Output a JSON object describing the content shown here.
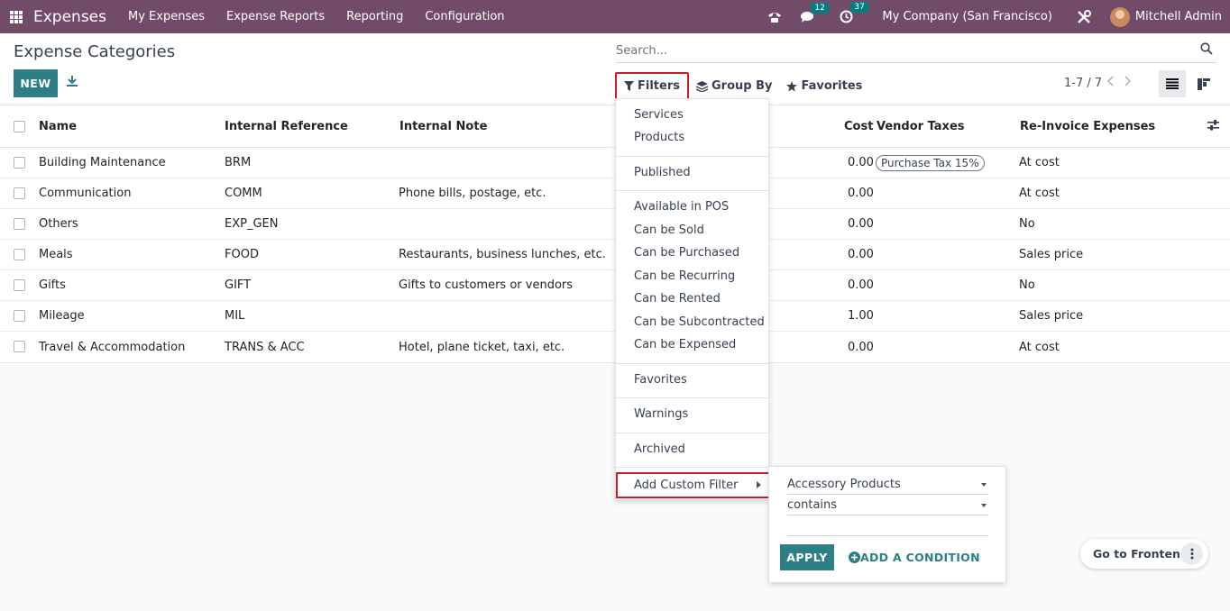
{
  "navbar": {
    "brand": "Expenses",
    "menu": [
      "My Expenses",
      "Expense Reports",
      "Reporting",
      "Configuration"
    ],
    "messages_count": "12",
    "activities_count": "37",
    "company": "My Company (San Francisco)",
    "user": "Mitchell Admin"
  },
  "control": {
    "title": "Expense Categories",
    "new_label": "NEW",
    "search_placeholder": "Search...",
    "filters_label": "Filters",
    "groupby_label": "Group By",
    "favorites_label": "Favorites",
    "pager": "1-7 / 7"
  },
  "table": {
    "columns": [
      "Name",
      "Internal Reference",
      "Internal Note",
      "Cost",
      "Vendor Taxes",
      "Re-Invoice Expenses"
    ],
    "rows": [
      {
        "name": "Building Maintenance",
        "ref": "BRM",
        "note": "",
        "cost": "0.00",
        "tax": "Purchase Tax 15%",
        "reinvoice": "At cost"
      },
      {
        "name": "Communication",
        "ref": "COMM",
        "note": "Phone bills, postage, etc.",
        "cost": "0.00",
        "tax": "",
        "reinvoice": "At cost"
      },
      {
        "name": "Others",
        "ref": "EXP_GEN",
        "note": "",
        "cost": "0.00",
        "tax": "",
        "reinvoice": "No"
      },
      {
        "name": "Meals",
        "ref": "FOOD",
        "note": "Restaurants, business lunches, etc.",
        "cost": "0.00",
        "tax": "",
        "reinvoice": "Sales price"
      },
      {
        "name": "Gifts",
        "ref": "GIFT",
        "note": "Gifts to customers or vendors",
        "cost": "0.00",
        "tax": "",
        "reinvoice": "No"
      },
      {
        "name": "Mileage",
        "ref": "MIL",
        "note": "",
        "cost": "1.00",
        "tax": "",
        "reinvoice": "Sales price"
      },
      {
        "name": "Travel & Accommodation",
        "ref": "TRANS & ACC",
        "note": "Hotel, plane ticket, taxi, etc.",
        "cost": "0.00",
        "tax": "",
        "reinvoice": "At cost"
      }
    ]
  },
  "filters": {
    "group1": [
      "Services",
      "Products"
    ],
    "group2": [
      "Published"
    ],
    "group3": [
      "Available in POS",
      "Can be Sold",
      "Can be Purchased",
      "Can be Recurring",
      "Can be Rented",
      "Can be Subcontracted",
      "Can be Expensed"
    ],
    "group4": [
      "Favorites"
    ],
    "group5": [
      "Warnings"
    ],
    "group6": [
      "Archived"
    ],
    "custom_label": "Add Custom Filter"
  },
  "custom_filter": {
    "field": "Accessory Products",
    "operator": "contains",
    "value": "",
    "apply_label": "APPLY",
    "add_condition_label": "ADD A CONDITION"
  },
  "frontend": {
    "label": "Go to Frontend"
  },
  "colors": {
    "brand": "#714b67",
    "primary": "#2d7f86",
    "highlight": "#d11a2a"
  }
}
